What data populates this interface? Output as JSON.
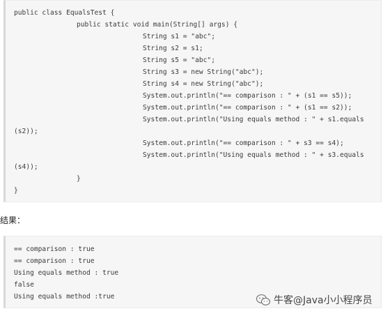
{
  "code_listing": {
    "lines": [
      "public class EqualsTest {",
      "public static void main(String[] args) {",
      "String s1 = \"abc\";",
      "String s2 = s1;",
      "String s5 = \"abc\";",
      "String s3 = new String(\"abc\");",
      "String s4 = new String(\"abc\");",
      "System.out.println(\"== comparison : \" + (s1 == s5));",
      "System.out.println(\"== comparison : \" + (s1 == s2));",
      "System.out.println(\"Using equals method : \" + s1.equals",
      "(s2));",
      "System.out.println(\"== comparison : \" + s3 == s4);",
      "System.out.println(\"Using equals method : \" + s3.equals",
      "(s4));",
      "}",
      "}"
    ]
  },
  "result_label": "结果：",
  "output_listing": {
    "lines": [
      "== comparison : true",
      "== comparison : true",
      "Using equals method : true",
      "false",
      "Using equals method :true"
    ]
  },
  "watermark": {
    "text": "牛客@Java小小程序员",
    "icon": "wechat-icon"
  }
}
